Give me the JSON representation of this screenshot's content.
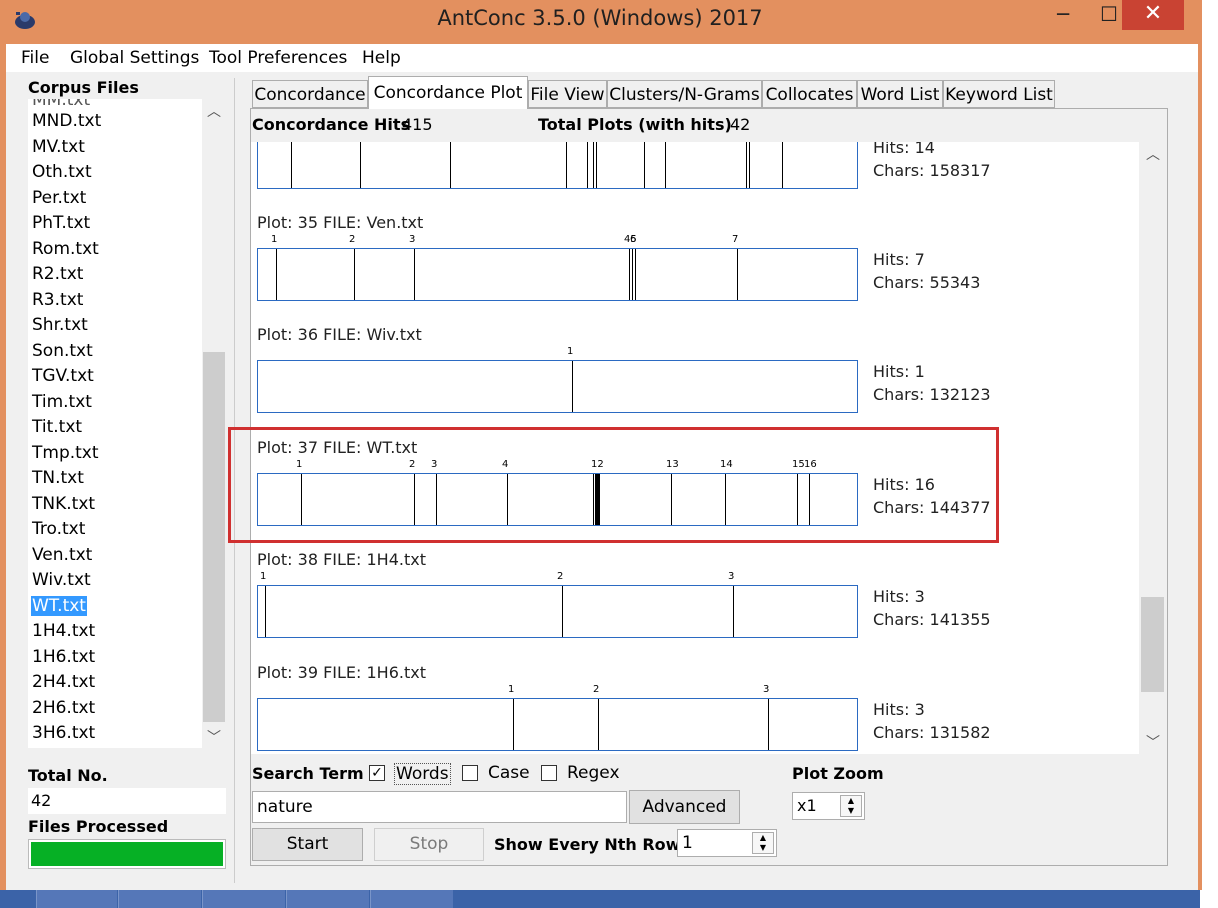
{
  "window": {
    "title": "AntConc 3.5.0 (Windows) 2017",
    "min": "─",
    "max": "☐",
    "close": "✕"
  },
  "menu": [
    "File",
    "Global Settings",
    "Tool Preferences",
    "Help"
  ],
  "corpus": {
    "label": "Corpus Files",
    "files": [
      "MND.txt",
      "MV.txt",
      "Oth.txt",
      "Per.txt",
      "PhT.txt",
      "Rom.txt",
      "R2.txt",
      "R3.txt",
      "Shr.txt",
      "Son.txt",
      "TGV.txt",
      "Tim.txt",
      "Tit.txt",
      "Tmp.txt",
      "TN.txt",
      "TNK.txt",
      "Tro.txt",
      "Ven.txt",
      "Wiv.txt",
      "WT.txt",
      "1H4.txt",
      "1H6.txt",
      "2H4.txt",
      "2H6.txt",
      "3H6.txt"
    ],
    "selected": "WT.txt",
    "total_label": "Total No.",
    "total_value": "42",
    "processed_label": "Files Processed",
    "progress": 1.0
  },
  "tabs": [
    "Concordance",
    "Concordance Plot",
    "File View",
    "Clusters/N-Grams",
    "Collocates",
    "Word List",
    "Keyword List"
  ],
  "active_tab": "Concordance Plot",
  "stats": {
    "hits_label": "Concordance Hits",
    "hits_value": "415",
    "plots_label": "Total Plots (with hits)",
    "plots_value": "42"
  },
  "plots": [
    {
      "title": "",
      "hits": "Hits: 14",
      "chars": "Chars: 158317",
      "marks": [
        0.055,
        0.17,
        0.32,
        0.515,
        0.55,
        0.56,
        0.565,
        0.645,
        0.68,
        0.815,
        0.82,
        0.875
      ],
      "labels": []
    },
    {
      "title": "Plot: 35   FILE: Ven.txt",
      "hits": "Hits: 7",
      "chars": "Chars: 55343",
      "marks": [
        0.03,
        0.16,
        0.26,
        0.62,
        0.625,
        0.63,
        0.8
      ],
      "labels": [
        {
          "t": "1",
          "p": 0.03
        },
        {
          "t": "2",
          "p": 0.16
        },
        {
          "t": "3",
          "p": 0.26
        },
        {
          "t": "45",
          "p": 0.62
        },
        {
          "t": "6",
          "p": 0.63
        },
        {
          "t": "7",
          "p": 0.8
        }
      ]
    },
    {
      "title": "Plot: 36   FILE: Wiv.txt",
      "hits": "Hits: 1",
      "chars": "Chars: 132123",
      "marks": [
        0.525
      ],
      "labels": [
        {
          "t": "1",
          "p": 0.525
        }
      ]
    },
    {
      "title": "Plot: 37   FILE: WT.txt",
      "hits": "Hits: 16",
      "chars": "Chars: 144377",
      "marks": [
        0.072,
        0.26,
        0.297,
        0.415,
        0.56,
        0.562,
        0.564,
        0.566,
        0.568,
        0.57,
        0.69,
        0.78,
        0.9,
        0.92
      ],
      "labels": [
        {
          "t": "1",
          "p": 0.072
        },
        {
          "t": "2",
          "p": 0.26
        },
        {
          "t": "3",
          "p": 0.297
        },
        {
          "t": "4",
          "p": 0.415
        },
        {
          "t": "12",
          "p": 0.565
        },
        {
          "t": "13",
          "p": 0.69
        },
        {
          "t": "14",
          "p": 0.78
        },
        {
          "t": "15",
          "p": 0.9
        },
        {
          "t": "16",
          "p": 0.92
        }
      ]
    },
    {
      "title": "Plot: 38   FILE: 1H4.txt",
      "hits": "Hits: 3",
      "chars": "Chars: 141355",
      "marks": [
        0.012,
        0.508,
        0.793
      ],
      "labels": [
        {
          "t": "1",
          "p": 0.012
        },
        {
          "t": "2",
          "p": 0.508
        },
        {
          "t": "3",
          "p": 0.793
        }
      ]
    },
    {
      "title": "Plot: 39   FILE: 1H6.txt",
      "hits": "Hits: 3",
      "chars": "Chars: 131582",
      "marks": [
        0.425,
        0.568,
        0.852
      ],
      "labels": [
        {
          "t": "1",
          "p": 0.425
        },
        {
          "t": "2",
          "p": 0.568
        },
        {
          "t": "3",
          "p": 0.852
        }
      ]
    }
  ],
  "search": {
    "label": "Search Term",
    "words_label": "Words",
    "words_checked": true,
    "case_label": "Case",
    "case_checked": false,
    "regex_label": "Regex",
    "regex_checked": false,
    "value": "nature",
    "advanced_label": "Advanced",
    "start_label": "Start",
    "stop_label": "Stop",
    "nth_label": "Show Every Nth Row",
    "nth_value": "1"
  },
  "zoom": {
    "label": "Plot Zoom",
    "value": "x1"
  },
  "colors": {
    "titlebar": "#e3905f",
    "accent": "#3399ff",
    "progress": "#06b025",
    "highlight": "#d03030",
    "plot_border": "#2b6ac2"
  }
}
